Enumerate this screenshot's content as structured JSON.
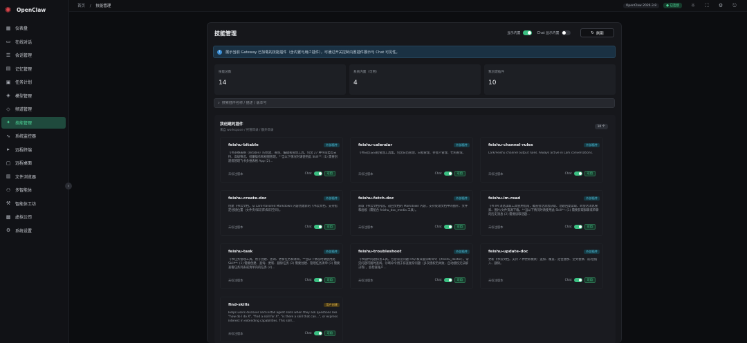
{
  "app": {
    "name": "OpenClaw"
  },
  "sidebar": {
    "items": [
      {
        "label": "仪表盘",
        "icon": "dashboard-icon",
        "active": false
      },
      {
        "label": "在线对话",
        "icon": "chat-icon",
        "active": false
      },
      {
        "label": "会话管理",
        "icon": "session-icon",
        "active": false
      },
      {
        "label": "记忆管理",
        "icon": "memory-icon",
        "active": false
      },
      {
        "label": "任务计划",
        "icon": "calendar-icon",
        "active": false
      },
      {
        "label": "模型管理",
        "icon": "model-icon",
        "active": false
      },
      {
        "label": "频道管理",
        "icon": "channel-icon",
        "active": false
      },
      {
        "label": "技能管理",
        "icon": "skill-icon",
        "active": true
      },
      {
        "label": "系统监控器",
        "icon": "monitor-icon",
        "active": false
      },
      {
        "label": "远程终端",
        "icon": "terminal-icon",
        "active": false
      },
      {
        "label": "远程桌面",
        "icon": "desktop-icon",
        "active": false
      },
      {
        "label": "文件浏览器",
        "icon": "folder-icon",
        "active": false
      },
      {
        "label": "多智能体",
        "icon": "agents-icon",
        "active": false
      },
      {
        "label": "智能体工坊",
        "icon": "workshop-icon",
        "active": false
      },
      {
        "label": "虚拟公司",
        "icon": "company-icon",
        "active": false
      },
      {
        "label": "系统设置",
        "icon": "settings-icon",
        "active": false
      }
    ]
  },
  "topbar": {
    "breadcrumb_home": "首页",
    "breadcrumb_sep": "/",
    "breadcrumb_current": "技能管理",
    "version": "OpenClaw 2026.3.8",
    "status": "● 已连接"
  },
  "panel": {
    "title": "技能管理",
    "toggle_builtin": "显示内置",
    "toggle_chat": "Chat 显示内置",
    "refresh_label": "刷新",
    "info": "展示当前 Gateway 已加载的技能插件（含内置与用户插件），可通过开关控制内置插件展示与 Chat 可见性。",
    "stats": [
      {
        "label": "技能总数",
        "value": "14"
      },
      {
        "label": "系统内置（可用）",
        "value": "4"
      },
      {
        "label": "我创建插件",
        "value": "10"
      }
    ],
    "search_placeholder": "搜索插件名称 / 描述 / 版本号",
    "section_title": "我创建的插件",
    "section_subtitle": "来自 workspace / 托管目录 / 额外目录",
    "section_count": "10 个"
  },
  "cards": [
    {
      "name": "feishu-bitable",
      "tag": "外部插件",
      "tag_type": "ext",
      "desc": "飞书多维表格（Bitable）的创建、查询、编辑和管理工具。包含 27 种字段类型支持、高级筛选、批量操作和视图管理。**当以下情况时请使用此 Skill**: (1) 需要创建或管理飞书多维表格 App (2)...",
      "version": "未标注版本",
      "chat": "Chat",
      "available": "可用"
    },
    {
      "name": "feishu-calendar",
      "tag": "外部插件",
      "tag_type": "ext",
      "desc": "飞书日历与日程管理工具集。包含日历管理、日程管理、参会人管理、忙闲查询。",
      "version": "未标注版本",
      "chat": "Chat",
      "available": "可用"
    },
    {
      "name": "feishu-channel-rules",
      "tag": "外部插件",
      "tag_type": "ext",
      "desc": "Lark/Feishu channel output rules. Always active in Lark conversations.",
      "version": "未标注版本",
      "chat": "Chat",
      "available": "可用"
    },
    {
      "name": "feishu-create-doc",
      "tag": "外部插件",
      "tag_type": "ext",
      "desc": "创建飞书云文档。从 Lark-flavored Markdown 内容创建新的飞书云文档，支持指定创建位置（文件夹/知识库/知识空间）。",
      "version": "未标注版本",
      "chat": "Chat",
      "available": "可用"
    },
    {
      "name": "feishu-fetch-doc",
      "tag": "外部插件",
      "tag_type": "ext",
      "desc": "获取飞书云文档内容。返回文档的 Markdown 内容，支持处理文档中的图片、文件和画板（需配合 feishu_doc_media 工具）。",
      "version": "未标注版本",
      "chat": "Chat",
      "available": "可用"
    },
    {
      "name": "feishu-im-read",
      "tag": "外部插件",
      "tag_type": "ext",
      "desc": "飞书 IM 消息读取工具使用指南，覆盖会话消息获取、话题回复读取、跨会话消息搜索、图片/文件资源下载。**当以下情况时请使用此 Skill**: (1) 需要获取群聊或单聊的历史消息 (2) 需要读取话题...",
      "version": "未标注版本",
      "chat": "Chat",
      "available": "可用"
    },
    {
      "name": "feishu-task",
      "tag": "外部插件",
      "tag_type": "ext",
      "desc": "飞书任务管理工具，用于创建、查询、更新任务和清单。**当以下情况时请使用此 Skill**: (1) 需要创建、查询、更新、删除任务 (2) 需要创建、管理任务清单 (3) 需要查看任务列表或清单内的任务 (4)...",
      "version": "未标注版本",
      "chat": "Chat",
      "available": "可用"
    },
    {
      "name": "feishu-troubleshoot",
      "tag": "外部插件",
      "tag_type": "ext",
      "desc": "飞书插件问题排查工具。包含常见问题 FAQ 和深度诊断命令（/feishu_doctor）。常见问题可随时查阅，诊断命令用于排查复杂问题（多次授权仍失败、自动授权无法解决等），会检查账户...",
      "version": "未标注版本",
      "chat": "Chat",
      "available": "可用"
    },
    {
      "name": "feishu-update-doc",
      "tag": "外部插件",
      "tag_type": "ext",
      "desc": "更新飞书云文档。支持 7 种更新模式：追加、覆盖、定位替换、全文替换、前/后插入、删除。",
      "version": "未标注版本",
      "chat": "Chat",
      "available": "可用"
    },
    {
      "name": "find-skills",
      "tag": "用户创建",
      "tag_type": "user",
      "desc": "Helps users discover and install agent skills when they ask questions like \"how do I do X\", \"find a skill for X\", \"is there a skill that can...\", or express interest in extending capabilities. This skill...",
      "version": "未标注版本",
      "chat": "Chat",
      "available": "可用"
    }
  ]
}
